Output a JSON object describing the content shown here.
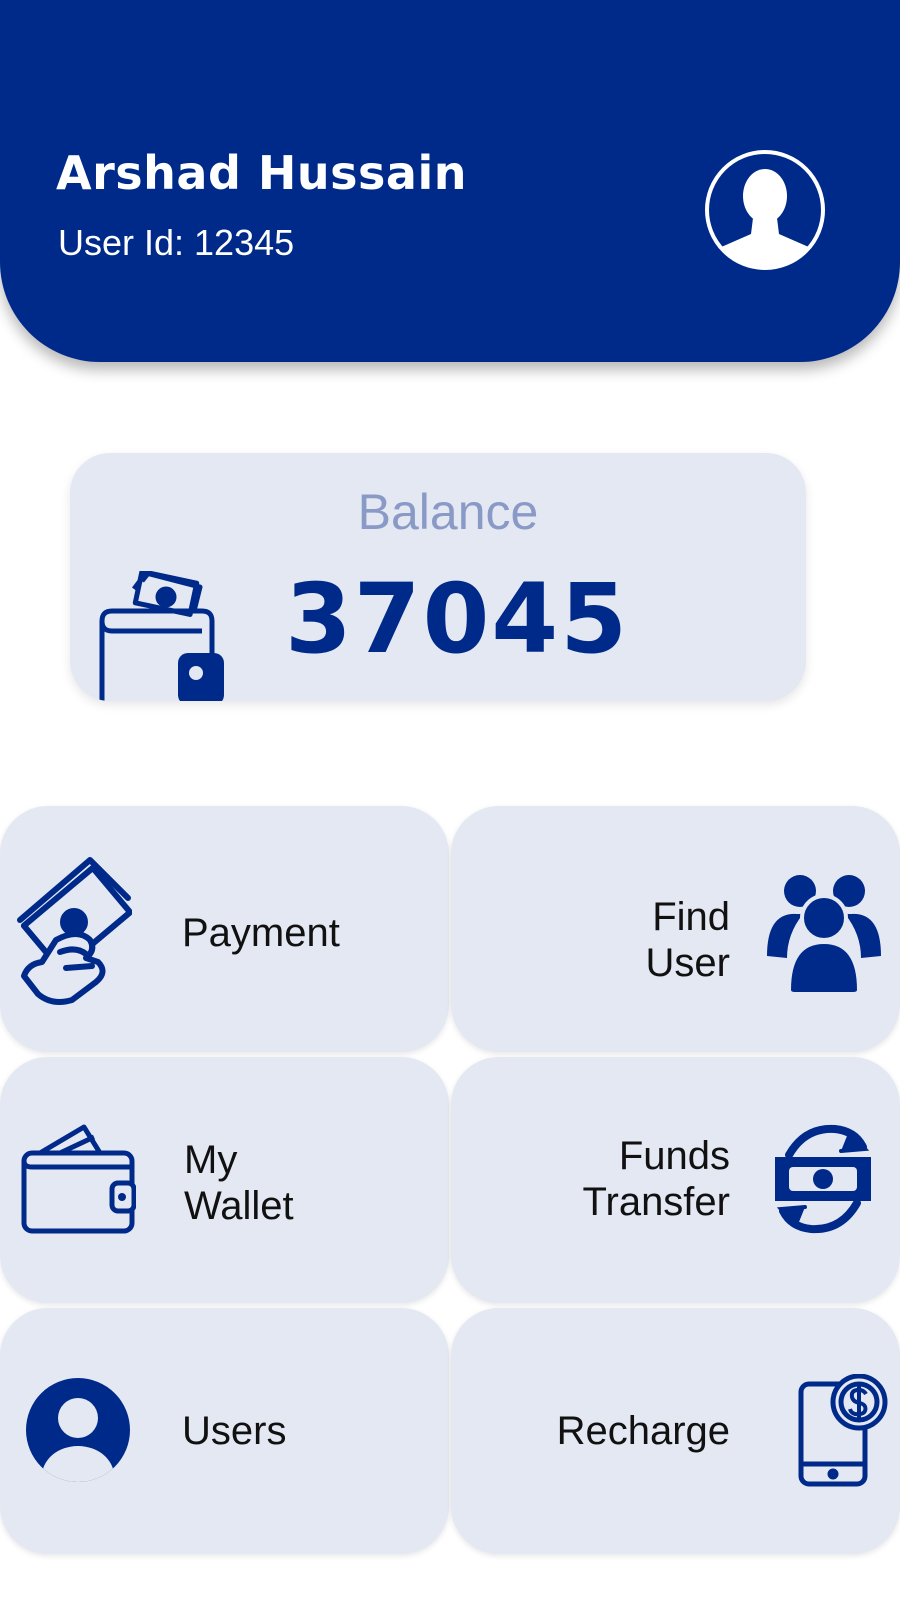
{
  "header": {
    "user_name": "Arshad Hussain",
    "user_id": "User Id: 12345",
    "avatar_icon": "user-avatar-icon"
  },
  "balance": {
    "label": "Balance",
    "value": "37045",
    "icon": "wallet-cash-icon"
  },
  "tiles": [
    {
      "id": "payment",
      "lines": [
        "Payment"
      ],
      "icon": "cash-hand-icon"
    },
    {
      "id": "find-user",
      "lines": [
        "Find",
        "User"
      ],
      "icon": "users-group-icon"
    },
    {
      "id": "my-wallet",
      "lines": [
        "My",
        "Wallet"
      ],
      "icon": "wallet-icon"
    },
    {
      "id": "funds-transfer",
      "lines": [
        "Funds",
        "Transfer"
      ],
      "icon": "money-exchange-icon"
    },
    {
      "id": "users",
      "lines": [
        "Users"
      ],
      "icon": "user-circle-icon"
    },
    {
      "id": "recharge",
      "lines": [
        "Recharge"
      ],
      "icon": "phone-dollar-icon"
    }
  ],
  "colors": {
    "primary": "#002a8a",
    "card_bg": "#e4e8f3",
    "balance_label": "#8a9ac6",
    "text": "#111111"
  }
}
